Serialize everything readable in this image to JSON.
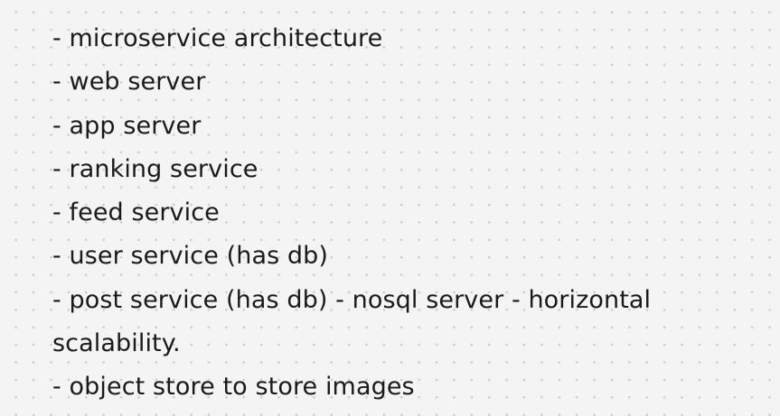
{
  "notes": {
    "lines": [
      "- microservice architecture",
      "- web server",
      "- app server",
      "- ranking service",
      "- feed service",
      "- user service (has db)",
      "- post service (has db) - nosql server - horizontal",
      "scalability.",
      "- object store to store images"
    ]
  }
}
